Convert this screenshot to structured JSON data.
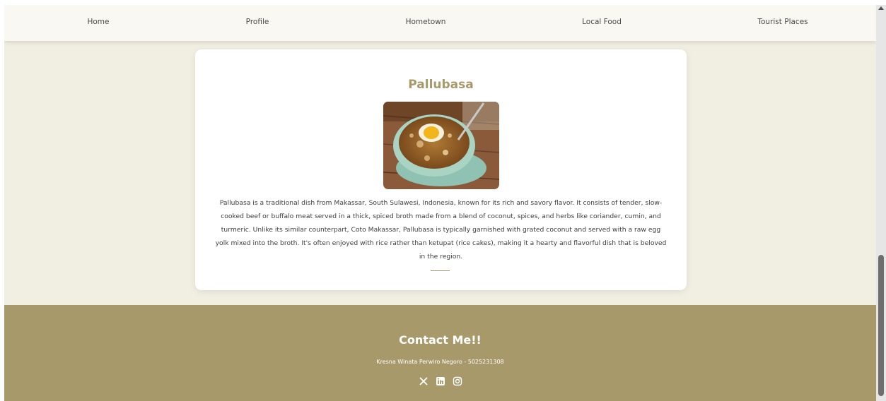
{
  "nav": {
    "items": [
      {
        "label": "Home"
      },
      {
        "label": "Profile"
      },
      {
        "label": "Hometown"
      },
      {
        "label": "Local Food"
      },
      {
        "label": "Tourist Places"
      }
    ]
  },
  "card": {
    "title": "Pallubasa",
    "image_icon": "pallubasa-photo",
    "description": "Pallubasa is a traditional dish from Makassar, South Sulawesi, Indonesia, known for its rich and savory flavor. It consists of tender, slow-cooked beef or buffalo meat served in a thick, spiced broth made from a blend of coconut, spices, and herbs like coriander, cumin, and turmeric. Unlike its similar counterpart, Coto Makassar, Pallubasa is typically garnished with grated coconut and served with a raw egg yolk mixed into the broth. It's often enjoyed with rice rather than ketupat (rice cakes), making it a hearty and flavorful dish that is beloved in the region."
  },
  "footer": {
    "title": "Contact Me!!",
    "subtitle": "Kresna Winata Perwiro Negoro - 5025231308",
    "social": [
      "x-icon",
      "linkedin-icon",
      "instagram-icon"
    ]
  },
  "colors": {
    "accent": "#a8996b",
    "page_bg": "#f1eee2",
    "nav_bg": "#faf8f2",
    "card_bg": "#ffffff"
  }
}
